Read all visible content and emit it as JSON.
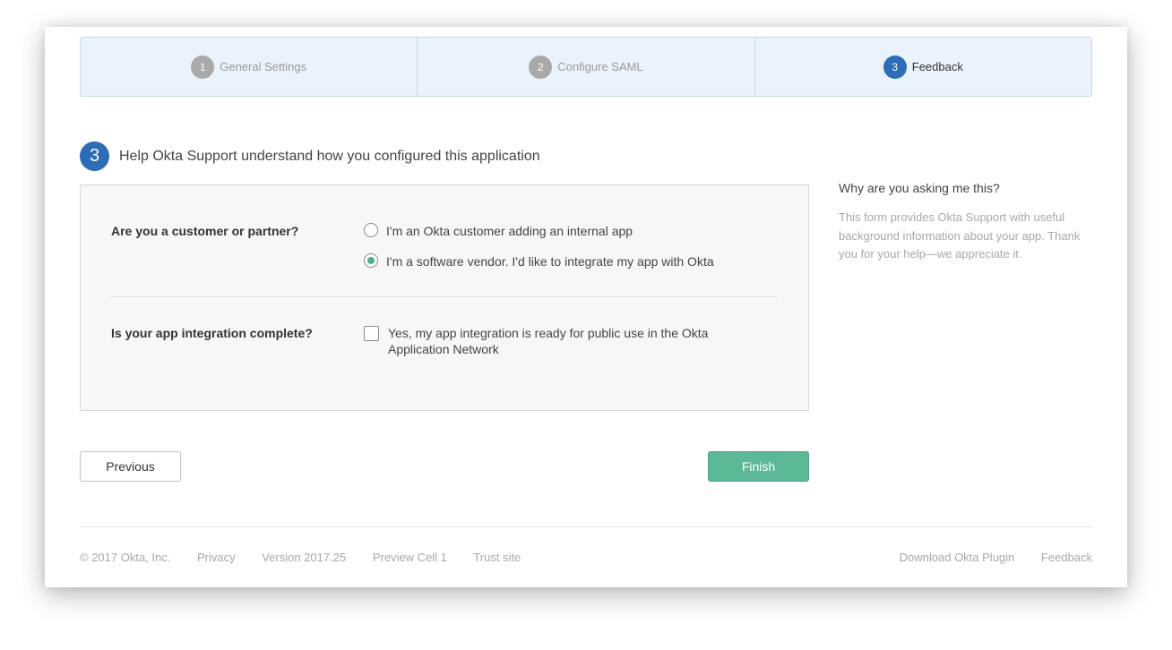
{
  "wizard": {
    "steps": [
      {
        "number": "1",
        "label": "General Settings",
        "active": false
      },
      {
        "number": "2",
        "label": "Configure SAML",
        "active": false
      },
      {
        "number": "3",
        "label": "Feedback",
        "active": true
      }
    ]
  },
  "section": {
    "number": "3",
    "title": "Help Okta Support understand how you configured this application"
  },
  "form": {
    "q1": {
      "label": "Are you a customer or partner?",
      "options": [
        {
          "label": "I'm an Okta customer adding an internal app",
          "selected": false
        },
        {
          "label": "I'm a software vendor. I'd like to integrate my app with Okta",
          "selected": true
        }
      ]
    },
    "q2": {
      "label": "Is your app integration complete?",
      "checkbox_label": "Yes, my app integration is ready for public use in the Okta Application Network",
      "checked": false
    }
  },
  "help": {
    "title": "Why are you asking me this?",
    "text": "This form provides Okta Support with useful background information about your app. Thank you for your help—we appreciate it."
  },
  "buttons": {
    "previous": "Previous",
    "finish": "Finish"
  },
  "footer": {
    "left": [
      "© 2017 Okta, Inc.",
      "Privacy",
      "Version 2017.25",
      "Preview Cell 1",
      "Trust site"
    ],
    "right": [
      "Download Okta Plugin",
      "Feedback"
    ]
  },
  "colors": {
    "accent_blue": "#2d6db5",
    "finish_green": "#5bb996",
    "radio_selected": "#4daf8b"
  }
}
